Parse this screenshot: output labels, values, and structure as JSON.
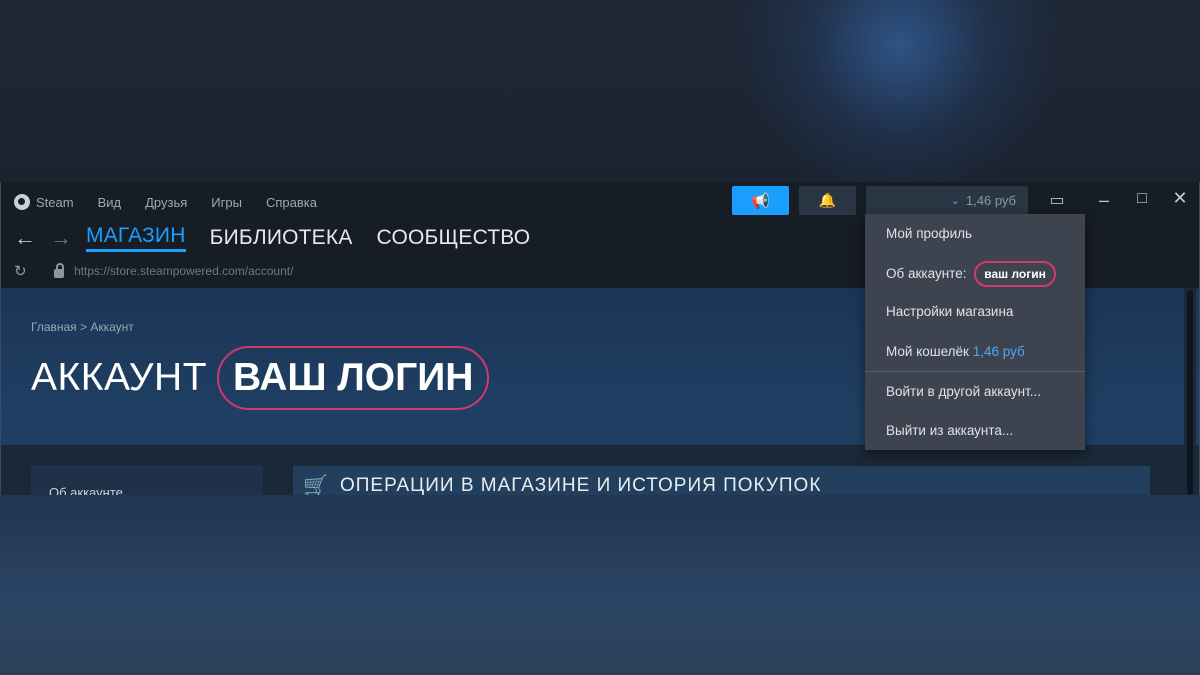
{
  "menubar": {
    "items": [
      "Steam",
      "Вид",
      "Друзья",
      "Игры",
      "Справка"
    ]
  },
  "nav": {
    "tabs": [
      "МАГАЗИН",
      "БИБЛИОТЕКА",
      "СООБЩЕСТВО"
    ]
  },
  "urlbar": {
    "url": "https://store.steampowered.com/account/"
  },
  "account_button": {
    "balance": "1,46 руб"
  },
  "breadcrumb": "Главная > Аккаунт",
  "page": {
    "title": "АККАУНТ",
    "login": "ВАШ ЛОГИН"
  },
  "sidebar": {
    "first_item": "Об аккаунте"
  },
  "section": {
    "title": "ОПЕРАЦИИ В МАГАЗИНЕ И ИСТОРИЯ ПОКУПОК"
  },
  "dropdown": {
    "profile": "Мой профиль",
    "about_label": "Об аккаунте:",
    "about_login": "ваш логин",
    "store_settings": "Настройки магазина",
    "wallet_label": "Мой кошелёк",
    "wallet_amount": "1,46 руб",
    "switch_account": "Войти в другой аккаунт...",
    "logout": "Выйти из аккаунта..."
  },
  "icons": {
    "announce": "megaphone-icon",
    "bell": "bell-icon",
    "screen": "monitor-icon",
    "cart": "cart-icon"
  },
  "colors": {
    "accent": "#1a9fff",
    "highlight": "#d1386e",
    "wallet": "#4fa8f2"
  }
}
